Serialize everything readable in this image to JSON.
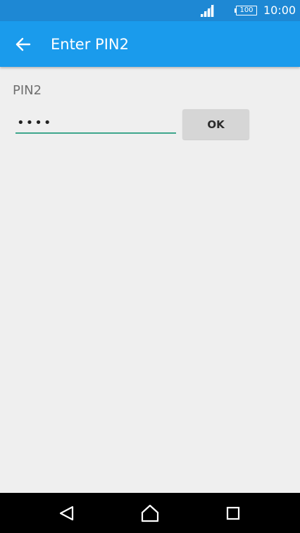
{
  "status_bar": {
    "battery_level": "100",
    "time": "10:00",
    "signal_icon": "signal-icon",
    "battery_icon": "battery-icon"
  },
  "app_bar": {
    "title": "Enter PIN2",
    "back_icon": "arrow-left-icon",
    "background": "#1a9bec"
  },
  "form": {
    "label": "PIN2",
    "pin_value": "1234",
    "ok_label": "OK",
    "underline_color": "#3ea68c"
  },
  "nav_bar": {
    "back_icon": "triangle-back-icon",
    "home_icon": "home-icon",
    "recents_icon": "square-recents-icon"
  }
}
